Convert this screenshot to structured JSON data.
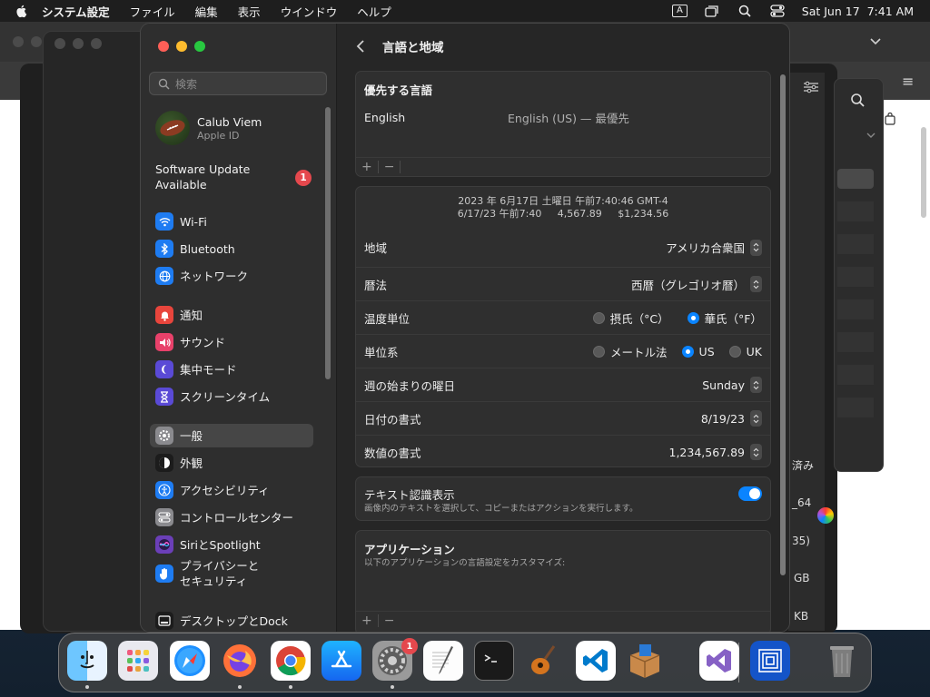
{
  "menubar": {
    "app": "システム設定",
    "items": [
      "ファイル",
      "編集",
      "表示",
      "ウインドウ",
      "ヘルプ"
    ],
    "input_mode": "A",
    "clock": "Sat Jun 17  7:41 AM"
  },
  "sidebar": {
    "search_placeholder": "検索",
    "profile": {
      "name": "Calub Viem",
      "sub": "Apple ID"
    },
    "software_update": {
      "label": "Software Update Available",
      "badge": "1"
    },
    "items": [
      {
        "label": "Wi-Fi",
        "icon": "wifi-icon",
        "color": "#1e7cf2"
      },
      {
        "label": "Bluetooth",
        "icon": "bluetooth-icon",
        "color": "#1e7cf2"
      },
      {
        "label": "ネットワーク",
        "icon": "globe-icon",
        "color": "#1e7cf2"
      },
      {
        "label": "通知",
        "icon": "bell-icon",
        "color": "#e8453c"
      },
      {
        "label": "サウンド",
        "icon": "speaker-icon",
        "color": "#e8416a"
      },
      {
        "label": "集中モード",
        "icon": "moon-icon",
        "color": "#5a4ad6"
      },
      {
        "label": "スクリーンタイム",
        "icon": "hourglass-icon",
        "color": "#5a4ad6"
      },
      {
        "label": "一般",
        "icon": "gear-icon",
        "color": "#8a8a8e"
      },
      {
        "label": "外観",
        "icon": "appearance-icon",
        "color": "#1c1c1c"
      },
      {
        "label": "アクセシビリティ",
        "icon": "accessibility-icon",
        "color": "#1e7cf2"
      },
      {
        "label": "コントロールセンター",
        "icon": "control-center-icon",
        "color": "#8a8a8e"
      },
      {
        "label": "SiriとSpotlight",
        "icon": "siri-icon",
        "color": "#6b3fb8"
      },
      {
        "label": "プライバシーと\nセキュリティ",
        "icon": "hand-icon",
        "color": "#1e7cf2"
      },
      {
        "label": "デスクトップとDock",
        "icon": "dock-icon",
        "color": "#1c1c1c"
      }
    ]
  },
  "content": {
    "title": "言語と地域",
    "preferred": {
      "header": "優先する言語",
      "language": "English",
      "detail": "English (US) — 最優先",
      "add": "+",
      "remove": "−"
    },
    "region": {
      "preview_line1": "2023 年 6月17日 土曜日 午前7:40:46 GMT-4",
      "preview_line2": "6/17/23 午前7:40     4,567.89     $1,234.56",
      "rows": {
        "region": {
          "label": "地域",
          "value": "アメリカ合衆国"
        },
        "calendar": {
          "label": "暦法",
          "value": "西暦（グレゴリオ暦）"
        },
        "temperature": {
          "label": "温度単位",
          "opt1": "摂氏（°C）",
          "opt2": "華氏（°F）",
          "selected": "華氏（°F）"
        },
        "measurement": {
          "label": "単位系",
          "opt1": "メートル法",
          "opt2": "US",
          "opt3": "UK",
          "selected": "US"
        },
        "first_day": {
          "label": "週の始まりの曜日",
          "value": "Sunday"
        },
        "date_format": {
          "label": "日付の書式",
          "value": "8/19/23"
        },
        "number_format": {
          "label": "数値の書式",
          "value": "1,234,567.89"
        }
      }
    },
    "live_text": {
      "title": "テキスト認識表示",
      "desc": "画像内のテキストを選択して、コピーまたはアクションを実行します。",
      "enabled": true
    },
    "applications": {
      "title": "アプリケーション",
      "desc": "以下のアプリケーションの言語設定をカスタマイズ:",
      "add": "+",
      "remove": "−"
    }
  },
  "background": {
    "fragments": [
      "済み",
      "_64",
      "35)",
      "GB",
      "KB"
    ]
  },
  "dock": {
    "apps": [
      "Finder",
      "Launchpad",
      "Safari",
      "Firefox",
      "Chrome",
      "App Store",
      "システム設定",
      "TextEdit",
      "ターミナル",
      "GarageBand",
      "Visual Studio Code",
      "Installer",
      "Visual Studio",
      "Remote Desktop",
      "ゴミ箱"
    ],
    "settings_badge": "1"
  }
}
